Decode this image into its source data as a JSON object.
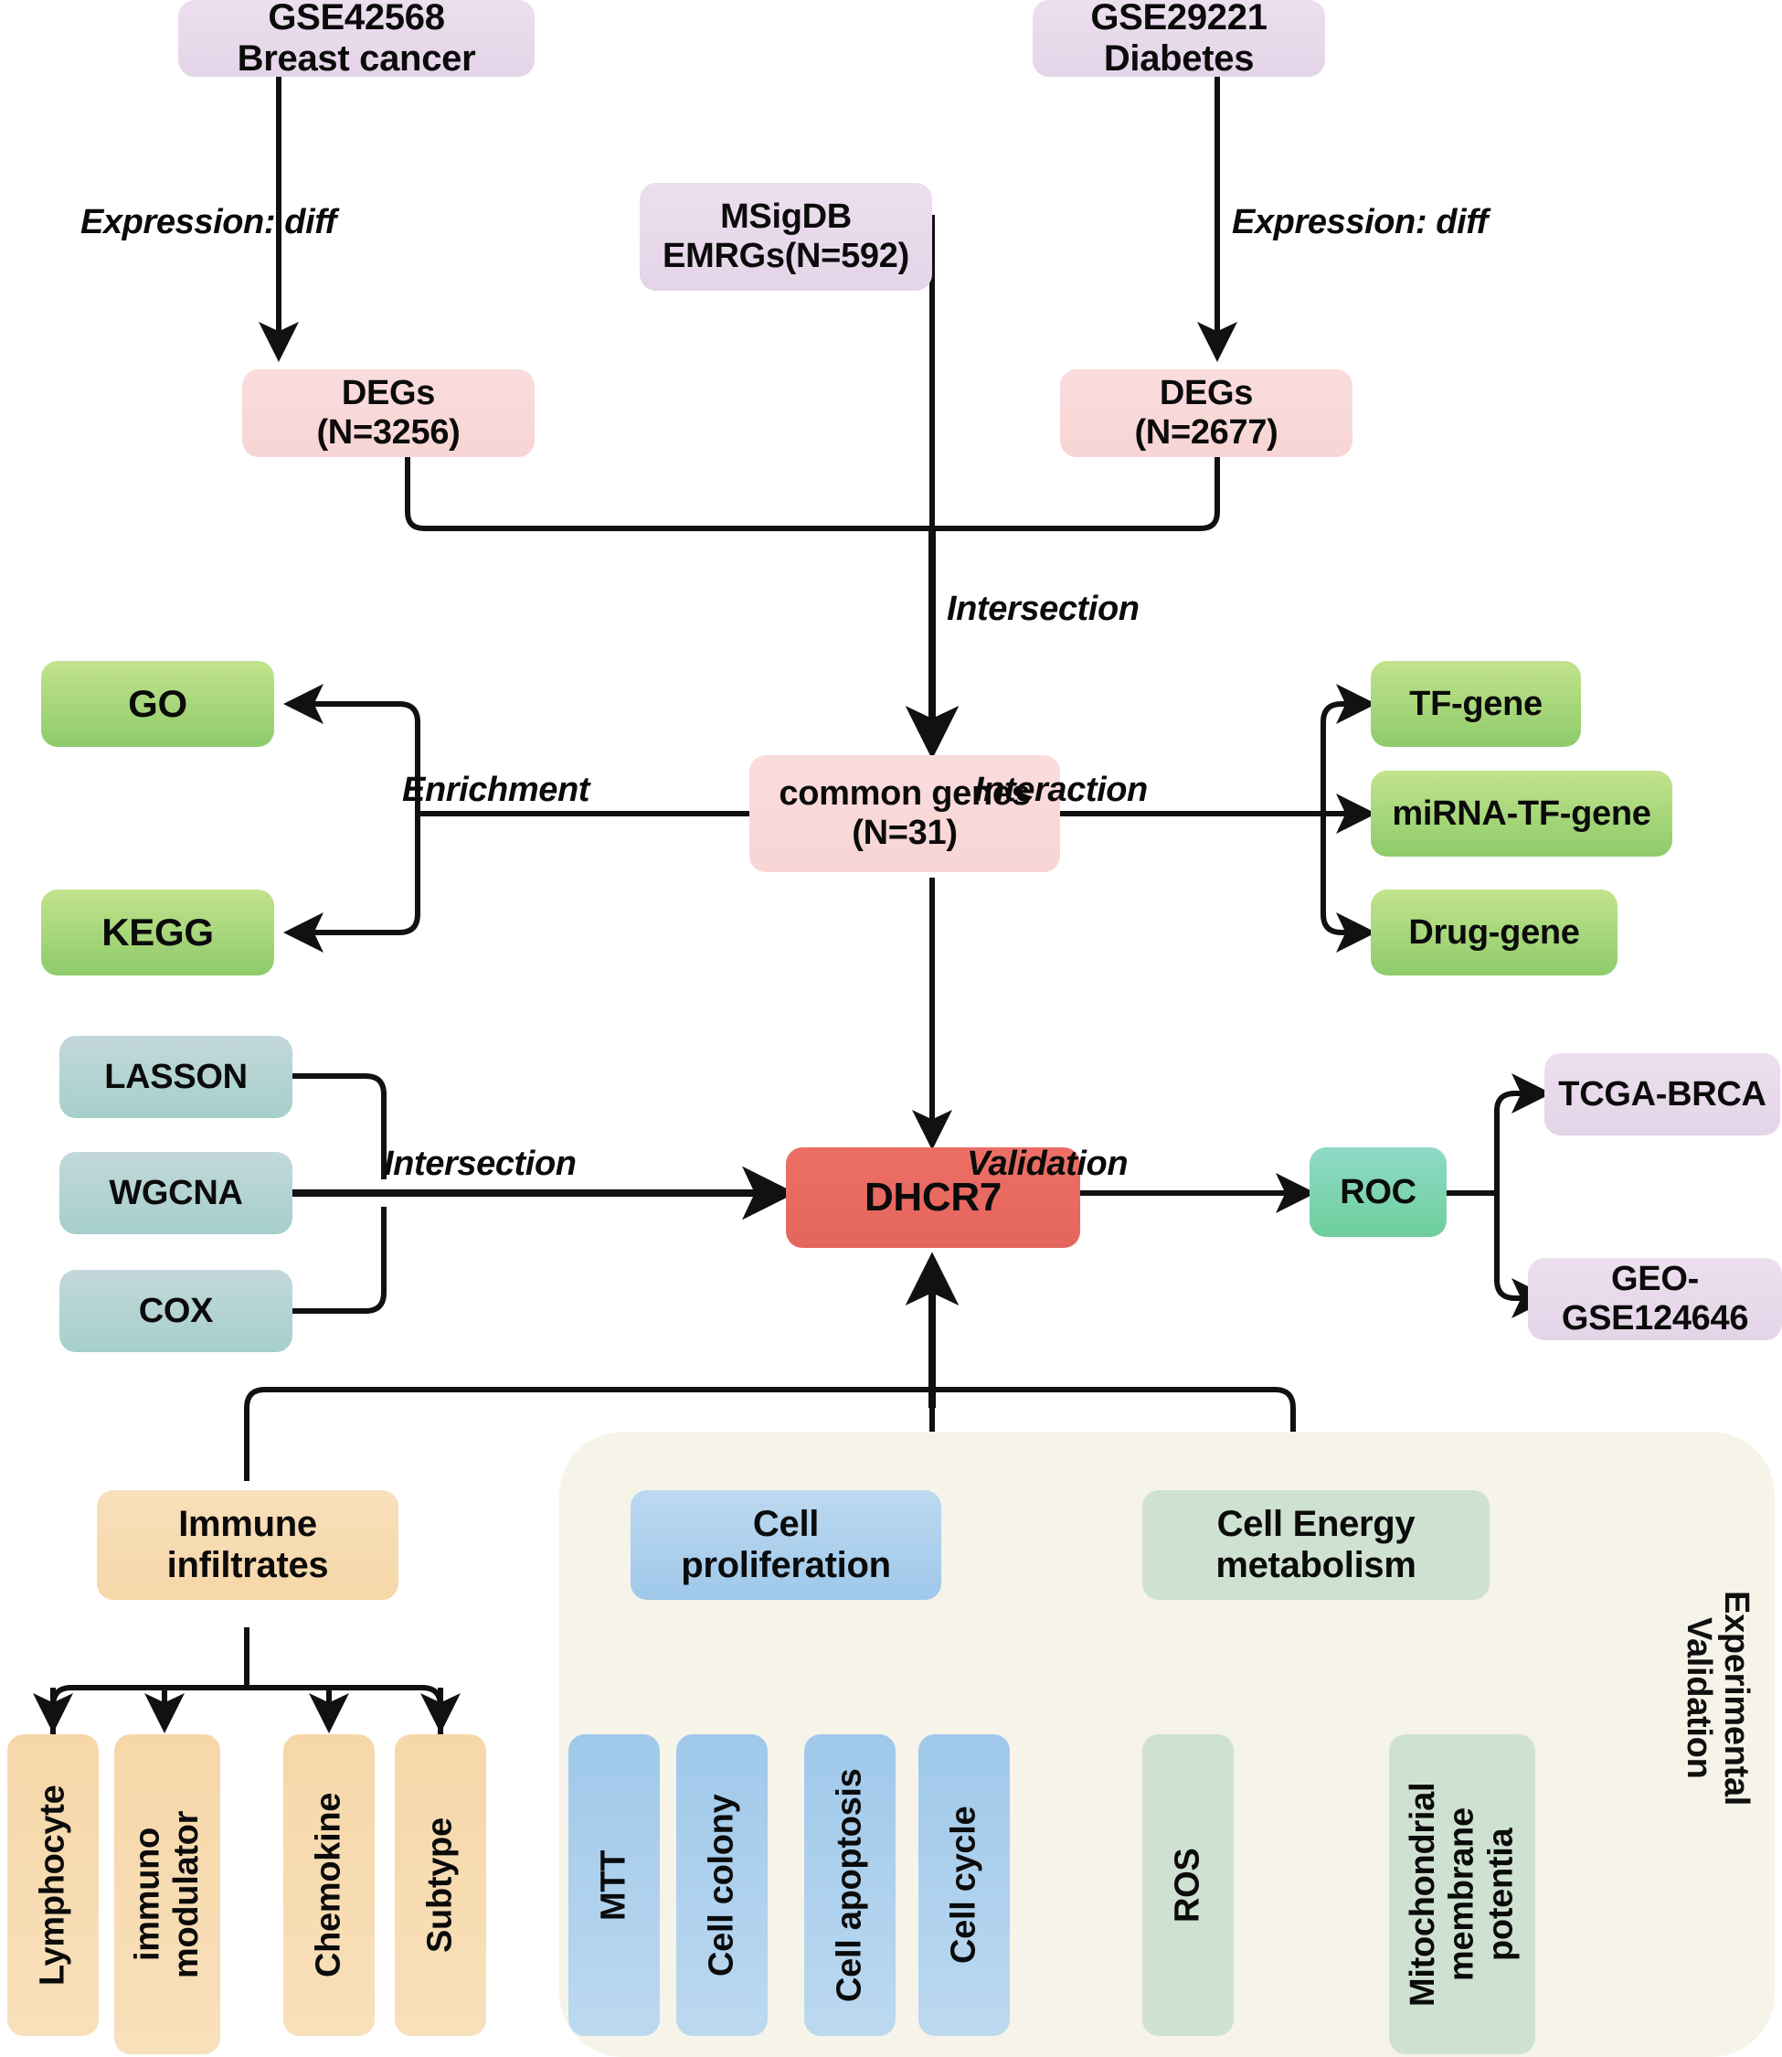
{
  "diagram": {
    "title": "DHCR7 bioinformatics and experimental validation workflow",
    "colors": {
      "purple": "#e8d8ec",
      "pink": "#f9d8d8",
      "green": "#9ccf6f",
      "teal": "#aed2d1",
      "red": "#e96a61",
      "mint": "#7ed3b3",
      "orange": "#f7dcb2",
      "blue": "#aed0ec",
      "sage": "#cfe2d2",
      "panel": "#f6f3e9",
      "stroke": "#111111"
    }
  },
  "sources": {
    "breast": "GSE42568\nBreast cancer",
    "msigdb": "MSigDB\nEMRGs(N=592)",
    "diabetes": "GSE29221\nDiabetes"
  },
  "degs": {
    "left": "DEGs\n(N=3256)",
    "right": "DEGs\n(N=2677)"
  },
  "common": {
    "label": "common genes\n(N=31)"
  },
  "enrichment": {
    "go": "GO",
    "kegg": "KEGG"
  },
  "interaction": {
    "tf_gene": "TF-gene",
    "mirna_tf_gene": "miRNA-TF-gene",
    "drug_gene": "Drug-gene"
  },
  "methods": {
    "lasson": "LASSON",
    "wgcna": "WGCNA",
    "cox": "COX"
  },
  "hub": {
    "gene": "DHCR7"
  },
  "validation": {
    "roc": "ROC",
    "tcga": "TCGA-BRCA",
    "geo": "GEO-GSE124646"
  },
  "experimental": {
    "panel_label": "Experimental\nValidation",
    "immune": {
      "title": "Immune\ninfiltrates",
      "children": [
        "Lymphocyte",
        "immuno\nmodulator",
        "Chemokine",
        "Subtype"
      ]
    },
    "proliferation": {
      "title": "Cell\nproliferation",
      "children": [
        "MTT",
        "Cell colony",
        "Cell apoptosis",
        "Cell cycle"
      ]
    },
    "energy": {
      "title": "Cell Energy\nmetabolism",
      "children": [
        "ROS",
        "Mitochondrial\nmembrane\npotentia"
      ]
    }
  },
  "edge_labels": {
    "expression_left": "Expression: diff",
    "expression_right": "Expression: diff",
    "intersection_top": "Intersection",
    "enrichment": "Enrichment",
    "interaction": "Interaction",
    "intersection_mid": "Intersection",
    "validation": "Validation"
  }
}
